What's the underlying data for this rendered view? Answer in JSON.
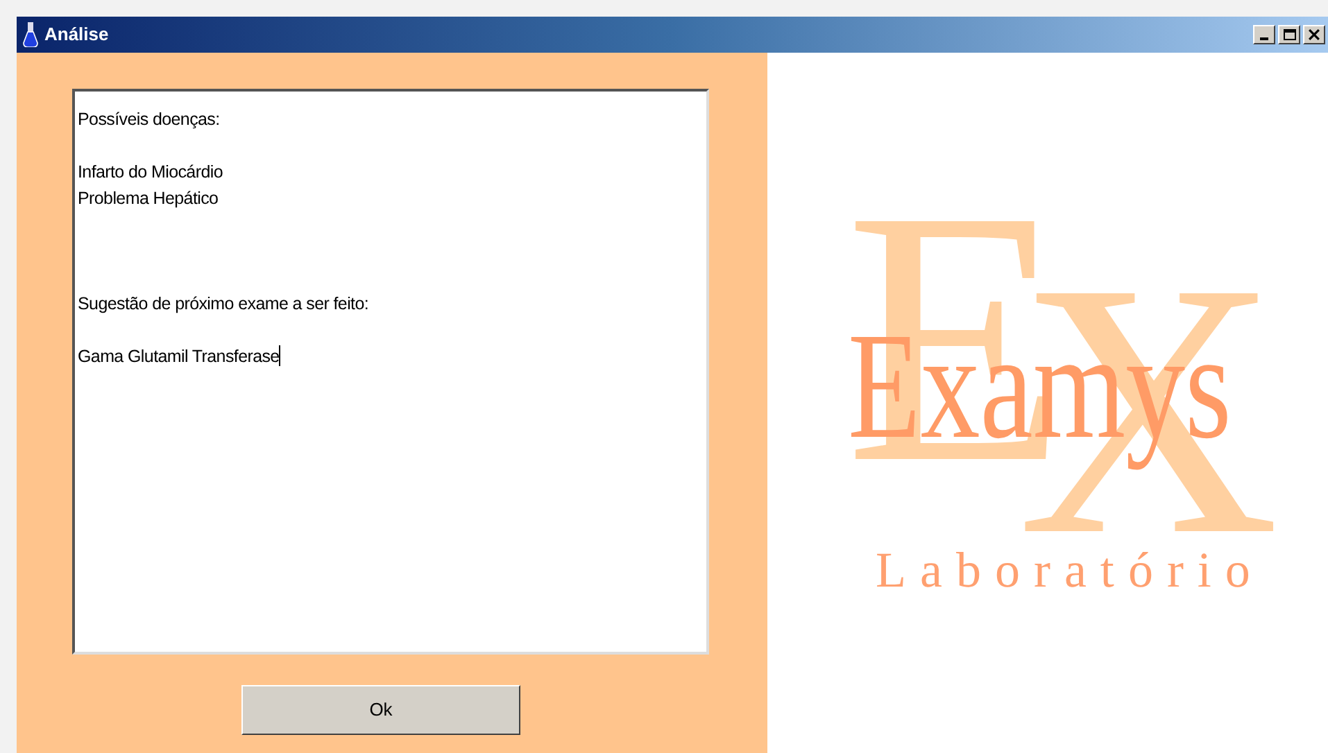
{
  "window": {
    "title": "Análise"
  },
  "result_field": {
    "focused": true,
    "sections": [
      {
        "heading": "Possíveis doenças:",
        "items": [
          "Infarto do Miocárdio",
          "Problema Hepático"
        ]
      },
      {
        "heading": "Sugestão de próximo exame a ser feito:",
        "items": [
          "Gama Glutamil Transferase"
        ]
      }
    ]
  },
  "buttons": [
    "Ok"
  ],
  "logo": {
    "big_letters": [
      "E",
      "X"
    ],
    "name": "Examys",
    "subtitle": "Laboratório"
  }
}
